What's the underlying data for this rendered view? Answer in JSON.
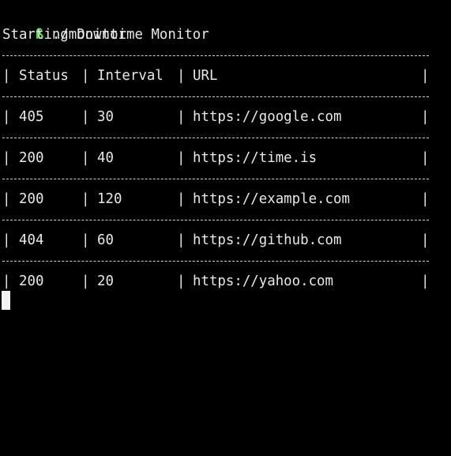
{
  "terminal": {
    "prompt_symbol": "ß",
    "command": "./monitor",
    "output_title": "Starting Downtime Monitor",
    "divider_text": "------------------------------------------------------------------------",
    "pipe": "|",
    "columns": [
      "Status",
      "Interval",
      "URL"
    ],
    "rows": [
      {
        "status": "405",
        "interval": "30",
        "url": "https://google.com"
      },
      {
        "status": "200",
        "interval": "40",
        "url": "https://time.is"
      },
      {
        "status": "200",
        "interval": "120",
        "url": "https://example.com"
      },
      {
        "status": "404",
        "interval": "60",
        "url": "https://github.com"
      },
      {
        "status": "200",
        "interval": "20",
        "url": "https://yahoo.com"
      }
    ],
    "colors": {
      "background": "#000000",
      "text": "#e8e8e8",
      "prompt": "#5fd75f",
      "cursor": "#f2f2f2"
    }
  }
}
